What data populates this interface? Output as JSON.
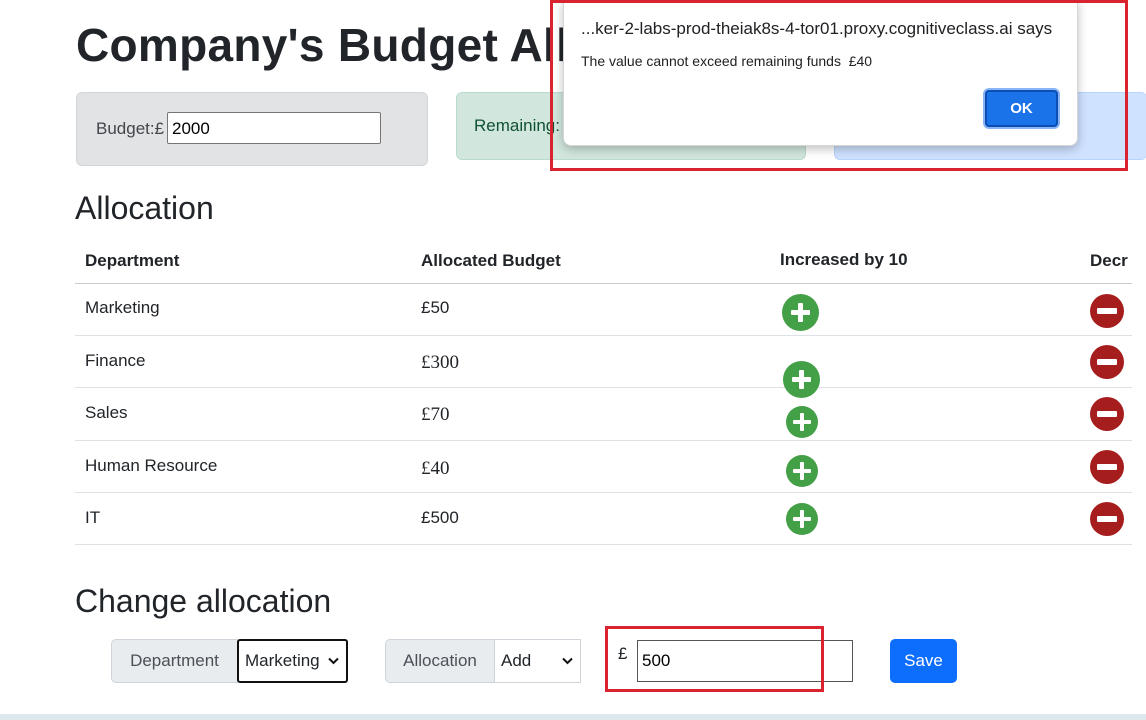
{
  "page": {
    "title": "Company's Budget Allo"
  },
  "budget": {
    "label": "Budget:£",
    "value": "2000"
  },
  "remaining": {
    "label": "Remaining:"
  },
  "allocation": {
    "heading": "Allocation",
    "columns": {
      "department": "Department",
      "allocated": "Allocated Budget",
      "increase": "Increased by 10",
      "decrease": "Decr"
    },
    "rows": [
      {
        "department": "Marketing",
        "budget": "£50"
      },
      {
        "department": "Finance",
        "budget": "£300"
      },
      {
        "department": "Sales",
        "budget": "£70"
      },
      {
        "department": "Human Resource",
        "budget": "£40"
      },
      {
        "department": "IT",
        "budget": "£500"
      }
    ],
    "icons": {
      "increase": "plus-circle-icon",
      "decrease": "minus-circle-icon"
    }
  },
  "change": {
    "heading": "Change allocation",
    "department_label": "Department",
    "department_selected": "Marketing",
    "allocation_label": "Allocation",
    "allocation_selected": "Add",
    "currency": "£",
    "amount": "500",
    "save_label": "Save"
  },
  "dialog": {
    "title": "...ker-2-labs-prod-theiak8s-4-tor01.proxy.cognitiveclass.ai says",
    "message": "The value cannot exceed remaining funds  £40",
    "ok_label": "OK"
  },
  "colors": {
    "increase": "#43a047",
    "decrease": "#a51d1d",
    "primary": "#0d6efd",
    "highlight": "#d9232e"
  }
}
